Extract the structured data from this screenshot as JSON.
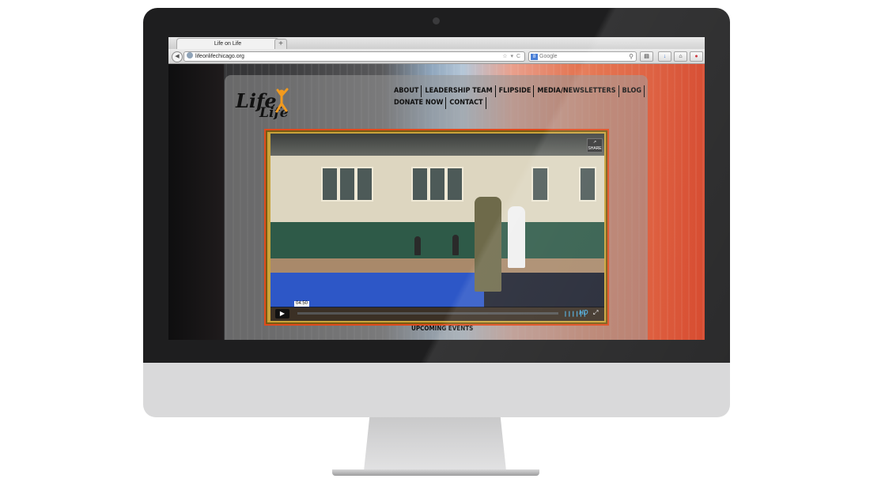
{
  "browser": {
    "tab_title": "Life on Life",
    "new_tab_label": "+",
    "back_label": "◀",
    "url": "lifeonlifechicago.org",
    "url_icons": "☆ ▾ C",
    "search_engine_label": "8",
    "search_placeholder": "Google",
    "search_icon": "magnifier-icon",
    "toolbar_buttons": [
      "bookmarks-icon",
      "download-icon",
      "home-icon",
      "pinterest-icon"
    ]
  },
  "site": {
    "logo_line1": "Life",
    "logo_line2": "Life",
    "nav_row1": [
      "ABOUT",
      "LEADERSHIP TEAM",
      "FLIPSIDE",
      "MEDIA/NEWSLETTERS",
      "BLOG"
    ],
    "nav_row2": [
      "DONATE NOW",
      "CONTACT"
    ],
    "upcoming_heading": "UPCOMING EVENTS"
  },
  "video": {
    "share_label": "SHARE",
    "play_icon": "play-icon",
    "time_badge": "04:50",
    "progress": 0.0,
    "volume_icon": "volume-bars-icon",
    "hd_label": "HD",
    "fullscreen_icon": "fullscreen-icon"
  },
  "colors": {
    "video_border": "#e04a1c",
    "video_controls_accent": "#4aa7d6",
    "logo_accent": "#f29a1e"
  }
}
